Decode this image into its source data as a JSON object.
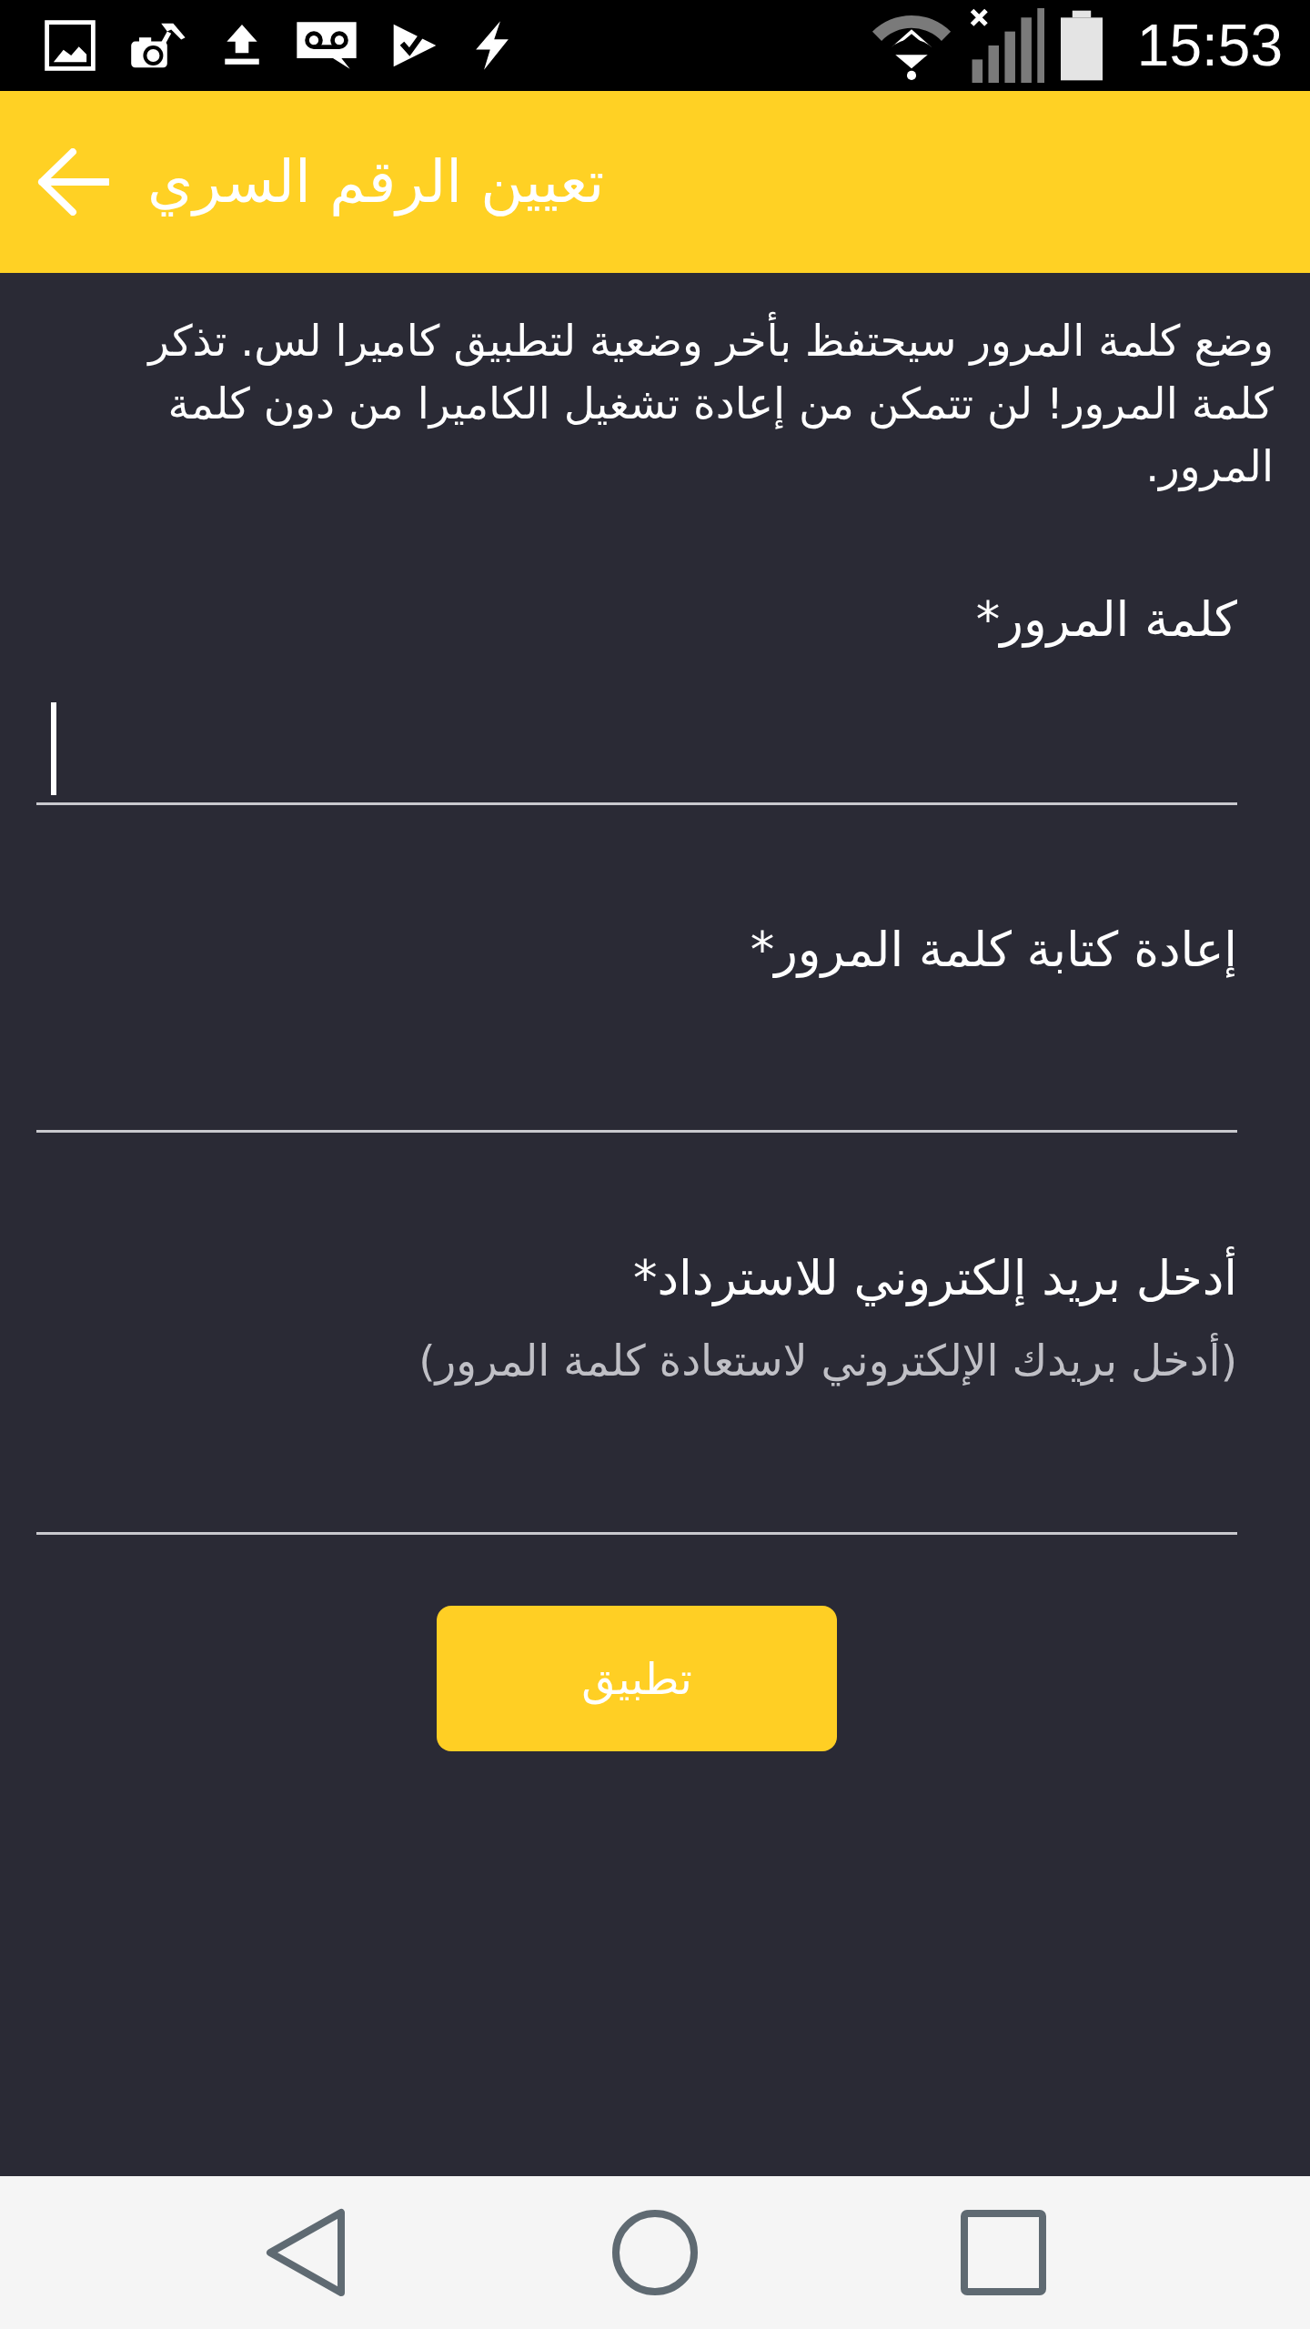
{
  "status_bar": {
    "time": "15:53"
  },
  "app_bar": {
    "title": "تعيين الرقم السري"
  },
  "intro": "وضع كلمة المرور سيحتفظ بأخر وضعية لتطبيق كاميرا لس. تذكر كلمة المرور! لن تتمكن من إعادة تشغيل الكاميرا من دون كلمة المرور.",
  "fields": [
    {
      "label": "كلمة المرور*",
      "focused": true
    },
    {
      "label": "إعادة كتابة كلمة المرور*",
      "focused": false
    },
    {
      "label": "أدخل بريد إلكتروني للاسترداد*",
      "note": "(أدخل بريدك الإلكتروني لاستعادة كلمة المرور)",
      "focused": false
    }
  ],
  "apply_button": "تطبيق"
}
